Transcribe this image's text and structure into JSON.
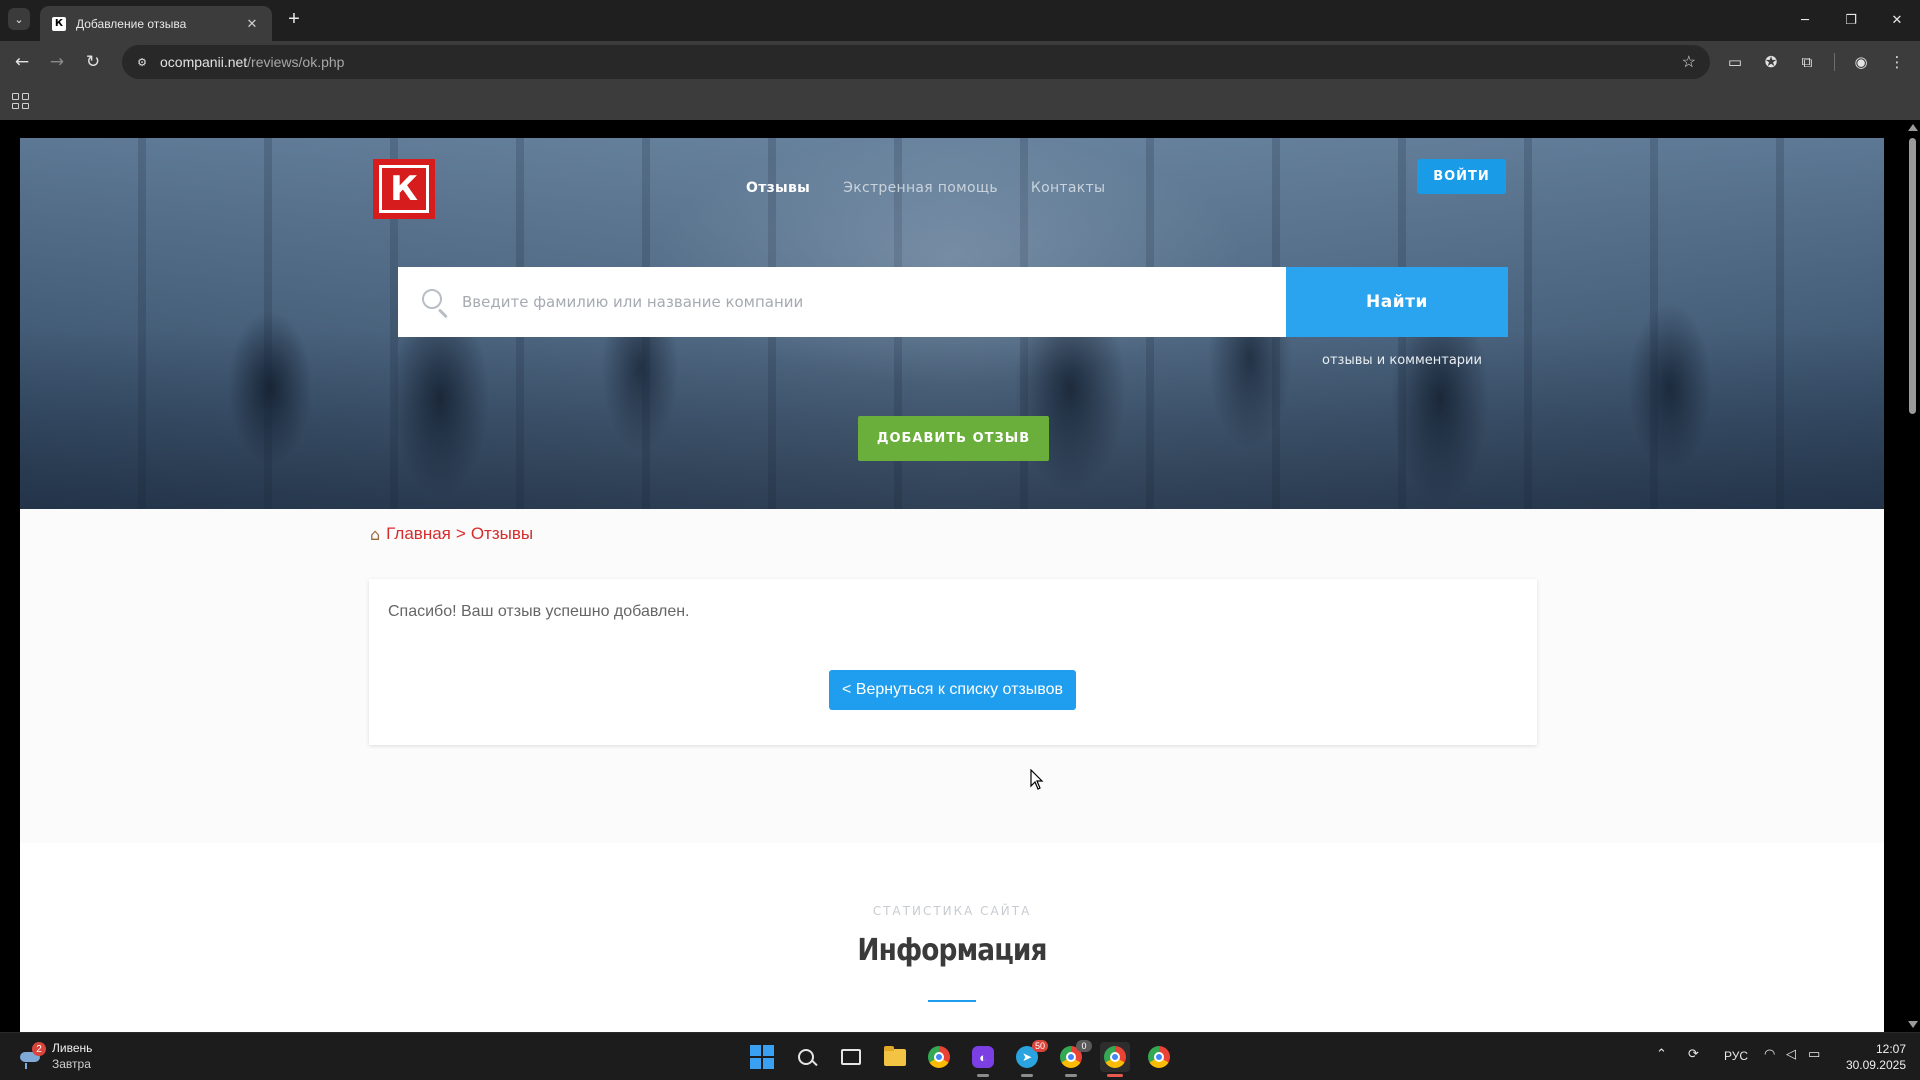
{
  "browser": {
    "tab_title": "Добавление отзыва",
    "tab_favicon": "К",
    "url_host": "ocompanii.net",
    "url_path": "/reviews/ok.php"
  },
  "site": {
    "nav": [
      "Отзывы",
      "Экстренная помощь",
      "Контакты"
    ],
    "login_label": "ВОЙТИ",
    "search_placeholder": "Введите фамилию или название компании",
    "search_button": "Найти",
    "search_sub": "отзывы и комментарии",
    "add_review": "ДОБАВИТЬ ОТЗЫВ"
  },
  "breadcrumb": {
    "home": "Главная",
    "separator": ">",
    "current": "Отзывы"
  },
  "message": {
    "text": "Спасибо! Ваш отзыв успешно добавлен.",
    "back_button": "< Вернуться к списку отзывов"
  },
  "info": {
    "kicker": "СТАТИСТИКА САЙТА",
    "title": "Информация"
  },
  "taskbar": {
    "weather_title": "Ливень",
    "weather_sub": "Завтра",
    "weather_badge": "2",
    "telegram_badge": "50",
    "app_badge": "0",
    "lang": "РУС",
    "time": "12:07",
    "date": "30.09.2025"
  },
  "colors": {
    "accent_blue": "#1f9ef0",
    "add_green": "#6aae3b",
    "logo_red": "#d61c1c",
    "breadcrumb_red": "#d62c2c"
  }
}
